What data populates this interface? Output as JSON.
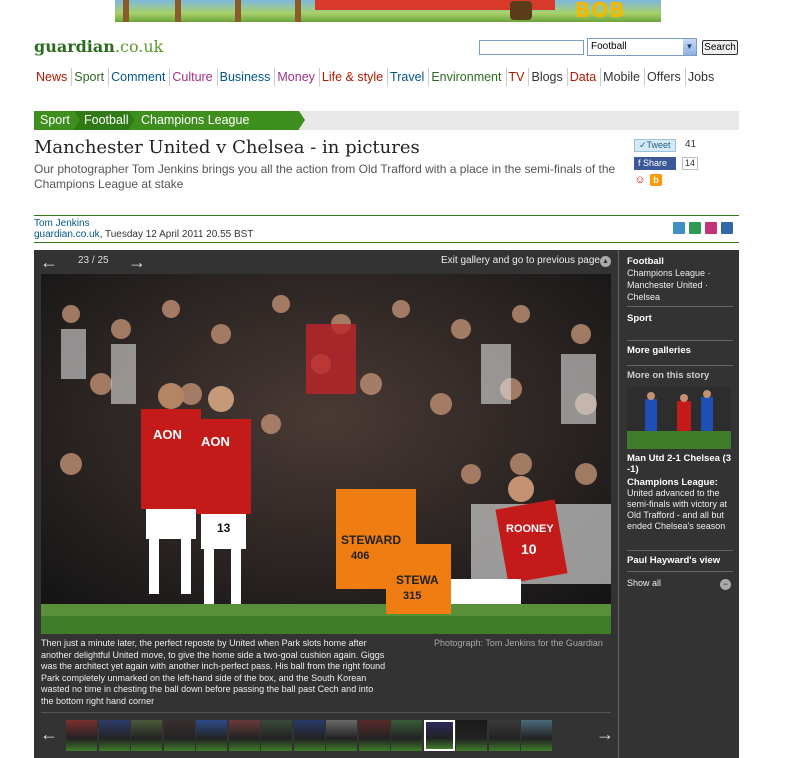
{
  "ad": {
    "text": "BOB"
  },
  "logo": {
    "name": "guardian",
    "tld": ".co.uk"
  },
  "search": {
    "placeholder": "",
    "select_value": "Football",
    "button": "Search"
  },
  "nav": [
    {
      "label": "News",
      "color": "#b51800"
    },
    {
      "label": "Sport",
      "color": "#2b6b1e"
    },
    {
      "label": "Comment",
      "color": "#005689"
    },
    {
      "label": "Culture",
      "color": "#a02f86"
    },
    {
      "label": "Business",
      "color": "#005689"
    },
    {
      "label": "Money",
      "color": "#a02f86"
    },
    {
      "label": "Life & style",
      "color": "#b51800"
    },
    {
      "label": "Travel",
      "color": "#005689"
    },
    {
      "label": "Environment",
      "color": "#2b6b1e"
    },
    {
      "label": "TV",
      "color": "#b51800"
    },
    {
      "label": "Blogs",
      "color": "#333333"
    },
    {
      "label": "Data",
      "color": "#b51800"
    },
    {
      "label": "Mobile",
      "color": "#333333"
    },
    {
      "label": "Offers",
      "color": "#333333"
    },
    {
      "label": "Jobs",
      "color": "#333333"
    }
  ],
  "breadcrumb": {
    "sport": "Sport",
    "football": "Football",
    "competition": "Champions League"
  },
  "article": {
    "title": "Manchester United v Chelsea - in pictures",
    "standfirst": "Our photographer Tom Jenkins brings you all the action from Old Trafford with a place in the semi-finals of the Champions League at stake",
    "author": "Tom Jenkins",
    "site": "guardian.co.uk",
    "date": ", Tuesday 12 April 2011 20.55 BST"
  },
  "social": {
    "tweet_label": "Tweet",
    "tweet_count": "41",
    "share_label": "Share",
    "share_count": "14"
  },
  "gallery": {
    "counter": "23 / 25",
    "exit_label": "Exit gallery and go to previous page",
    "caption": "Then just a minute later, the perfect reposte by United when Park slots home after another delightful United move, to give the home side a two-goal cushion again. Giggs was the architect yet again with another inch-perfect pass. His ball from the right found Park completely unmarked on the left-hand side of the box, and the South Korean wasted no time in chesting the ball down before passing the ball past Cech and into the bottom right hand corner",
    "credit": "Photograph: Tom Jenkins for the Guardian",
    "photo_text": {
      "shirt_left": "AON",
      "shirt_right": "AON",
      "number": "13",
      "steward1": "STEWARD",
      "steward1_num": "406",
      "steward2": "STEWA",
      "steward2_num": "315",
      "kneeling_name": "ROONEY",
      "kneeling_number": "10"
    }
  },
  "sidebar": {
    "section": "Football",
    "links": [
      "Champions League ·",
      "Manchester United ·",
      "Chelsea"
    ],
    "sport": "Sport",
    "more_galleries": "More galleries",
    "more_on_story": "More on this story",
    "story_title": "Man Utd 2-1 Chelsea (3-1)",
    "story_title_l1": "Man Utd 2-1 Chelsea (3",
    "story_title_l2": "-1)",
    "story_label": "Champions League:",
    "story_text": "United advanced to the semi-finals with victory at Old Trafford - and all but ended Chelsea's season",
    "hayward": "Paul Hayward's view",
    "show_all": "Show all"
  }
}
